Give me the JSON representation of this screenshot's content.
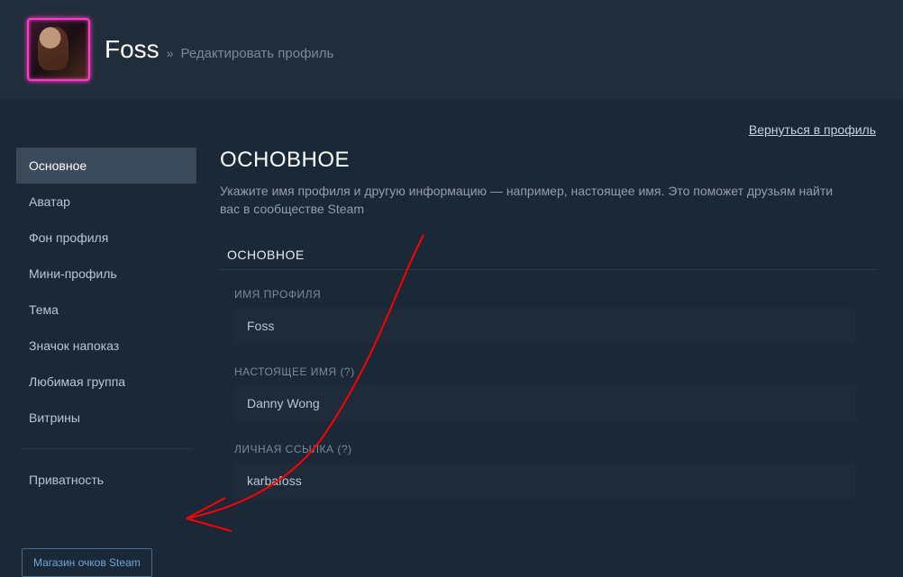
{
  "header": {
    "username": "Foss",
    "separator": "»",
    "subtitle": "Редактировать профиль"
  },
  "back_link": "Вернуться в профиль",
  "sidebar": {
    "items": [
      {
        "label": "Основное",
        "active": true
      },
      {
        "label": "Аватар",
        "active": false
      },
      {
        "label": "Фон профиля",
        "active": false
      },
      {
        "label": "Мини-профиль",
        "active": false
      },
      {
        "label": "Тема",
        "active": false
      },
      {
        "label": "Значок напоказ",
        "active": false
      },
      {
        "label": "Любимая группа",
        "active": false
      },
      {
        "label": "Витрины",
        "active": false
      }
    ],
    "privacy": "Приватность",
    "points_shop": "Магазин очков Steam"
  },
  "main": {
    "title": "ОСНОВНОЕ",
    "description": "Укажите имя профиля и другую информацию — например, настоящее имя. Это поможет друзьям найти вас в сообществе Steam",
    "section": "ОСНОВНОЕ",
    "fields": {
      "profile_name": {
        "label": "ИМЯ ПРОФИЛЯ",
        "value": "Foss"
      },
      "real_name": {
        "label": "НАСТОЯЩЕЕ ИМЯ",
        "hint": "(?)",
        "value": "Danny Wong"
      },
      "custom_url": {
        "label": "ЛИЧНАЯ ССЫЛКА",
        "hint": "(?)",
        "value": "karbafoss"
      }
    }
  },
  "annotation": {
    "color": "#ff0000"
  }
}
